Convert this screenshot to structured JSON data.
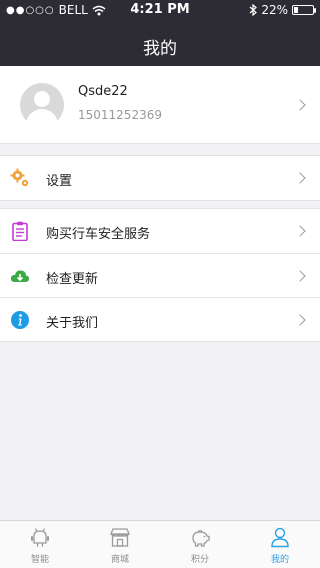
{
  "status_bar": {
    "signal": "●●○○○",
    "carrier": "BELL",
    "time": "4:21 PM",
    "battery": "22%"
  },
  "nav": {
    "title": "我的"
  },
  "profile": {
    "name": "Qsde22",
    "phone": "15011252369"
  },
  "menu": {
    "settings": {
      "label": "设置",
      "icon": "gear-icon"
    },
    "buy_service": {
      "label": "购买行车安全服务",
      "icon": "clipboard-icon"
    },
    "check_update": {
      "label": "检查更新",
      "icon": "cloud-download-icon"
    },
    "about": {
      "label": "关于我们",
      "icon": "info-icon"
    }
  },
  "tabs": [
    {
      "label": "智能",
      "icon": "robot-icon",
      "active": false
    },
    {
      "label": "商城",
      "icon": "store-icon",
      "active": false
    },
    {
      "label": "积分",
      "icon": "piggy-bank-icon",
      "active": false
    },
    {
      "label": "我的",
      "icon": "person-icon",
      "active": true
    }
  ],
  "colors": {
    "header_bg": "#2d2c35",
    "accent": "#2aa1e0",
    "gear": "#f1a33b",
    "clipboard": "#c53ad6",
    "cloud": "#3aaa45",
    "info": "#1d9be6"
  }
}
